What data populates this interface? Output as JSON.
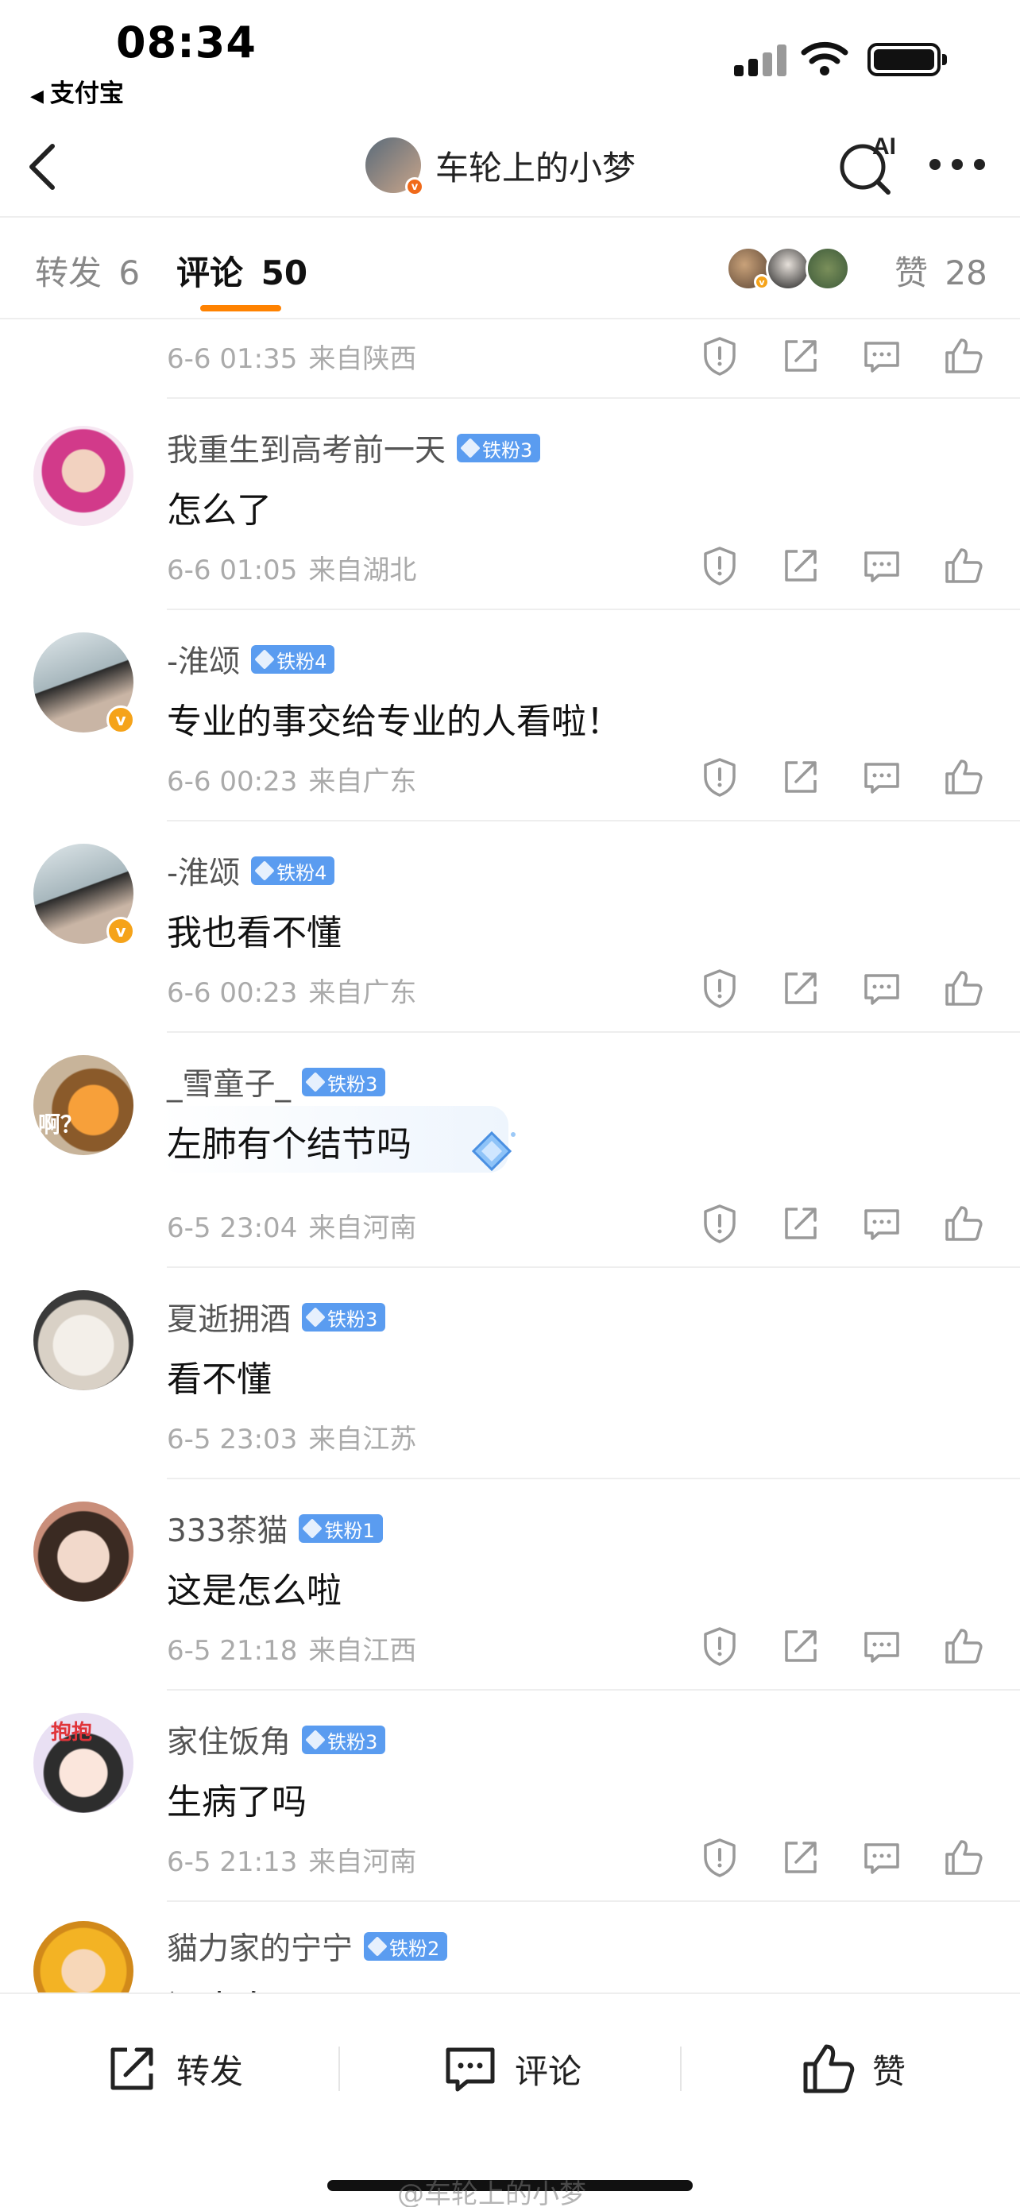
{
  "status": {
    "time": "08:34",
    "back_app": "支付宝"
  },
  "nav": {
    "title": "车轮上的小梦",
    "ai_label": "AI"
  },
  "tabs": {
    "repost_label": "转发",
    "repost_count": "6",
    "comments_label": "评论",
    "comments_count": "50",
    "likes_label": "赞",
    "likes_count": "28"
  },
  "colors": {
    "accent": "#ff8200",
    "fan_badge": "#5a9cf0",
    "verified": "#f5a31a"
  },
  "comments": [
    {
      "user": "",
      "fan": "",
      "text": "",
      "date": "6-6 01:35",
      "source": "来自陕西"
    },
    {
      "user": "我重生到高考前一天",
      "fan": "铁粉3",
      "text": "怎么了",
      "date": "6-6 01:05",
      "source": "来自湖北"
    },
    {
      "user": "-淮颂",
      "fan": "铁粉4",
      "text": "专业的事交给专业的人看啦！",
      "date": "6-6 00:23",
      "source": "来自广东"
    },
    {
      "user": "-淮颂",
      "fan": "铁粉4",
      "text": "我也看不懂",
      "date": "6-6 00:23",
      "source": "来自广东"
    },
    {
      "user": "_雪童子_",
      "fan": "铁粉3",
      "text": "左肺有个结节吗",
      "date": "6-5 23:04",
      "source": "来自河南",
      "avatar_text": "啊？"
    },
    {
      "user": "夏逝拥酒",
      "fan": "铁粉3",
      "text": "看不懂",
      "date": "6-5 23:03",
      "source": "来自江苏"
    },
    {
      "user": "333茶猫",
      "fan": "铁粉1",
      "text": "这是怎么啦",
      "date": "6-5 21:18",
      "source": "来自江西"
    },
    {
      "user": "家住饭角",
      "fan": "铁粉3",
      "text": "生病了吗",
      "date": "6-5 21:13",
      "source": "来自河南",
      "avatar_text": "抱抱"
    },
    {
      "user": "貓力家的宁宁",
      "fan": "铁粉2",
      "text": "问大白",
      "date": "",
      "source": ""
    }
  ],
  "bottom_bar": {
    "repost": "转发",
    "comment": "评论",
    "like": "赞"
  },
  "watermark": "@车轮上的小梦",
  "icons": [
    "back-icon",
    "ai-search-icon",
    "more-icon",
    "report-icon",
    "share-icon",
    "reply-icon",
    "like-icon",
    "repost-icon",
    "comment-icon",
    "signal-icon",
    "wifi-icon",
    "battery-icon"
  ]
}
